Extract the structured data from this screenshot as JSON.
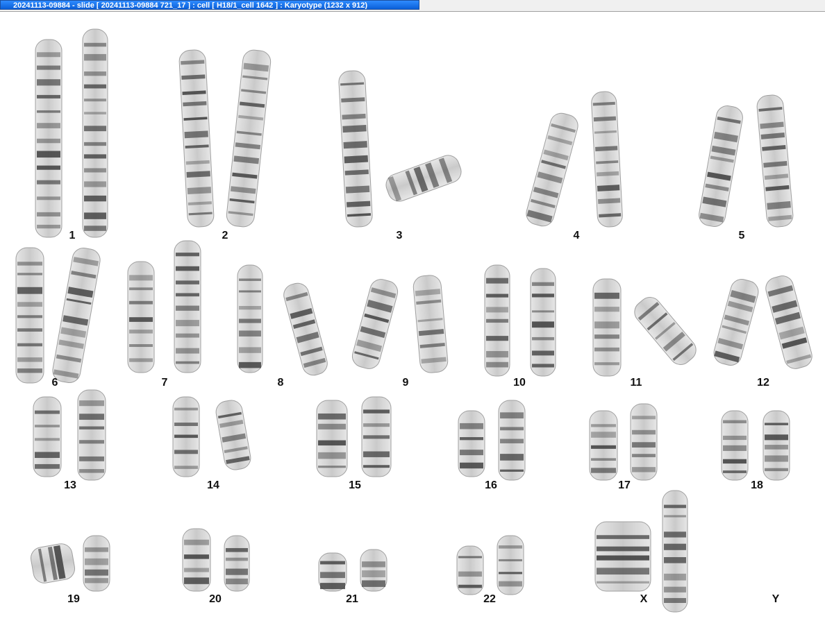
{
  "window": {
    "title": "20241113-09884 - slide [ 20241113-09884 721_17 ] : cell [ H18/1_cell 1642 ] : Karyotype  (1232 x 912)"
  },
  "karyotype": {
    "groups": [
      {
        "label": "1"
      },
      {
        "label": "2"
      },
      {
        "label": "3"
      },
      {
        "label": "4"
      },
      {
        "label": "5"
      },
      {
        "label": "6"
      },
      {
        "label": "7"
      },
      {
        "label": "8"
      },
      {
        "label": "9"
      },
      {
        "label": "10"
      },
      {
        "label": "11"
      },
      {
        "label": "12"
      },
      {
        "label": "13"
      },
      {
        "label": "14"
      },
      {
        "label": "15"
      },
      {
        "label": "16"
      },
      {
        "label": "17"
      },
      {
        "label": "18"
      },
      {
        "label": "19"
      },
      {
        "label": "20"
      },
      {
        "label": "21"
      },
      {
        "label": "22"
      },
      {
        "label": "X"
      },
      {
        "label": "Y"
      }
    ],
    "colors": {
      "chromatid": "#d8d8d8",
      "band": "#3a3a3a",
      "outline": "#9a9a9a"
    }
  }
}
